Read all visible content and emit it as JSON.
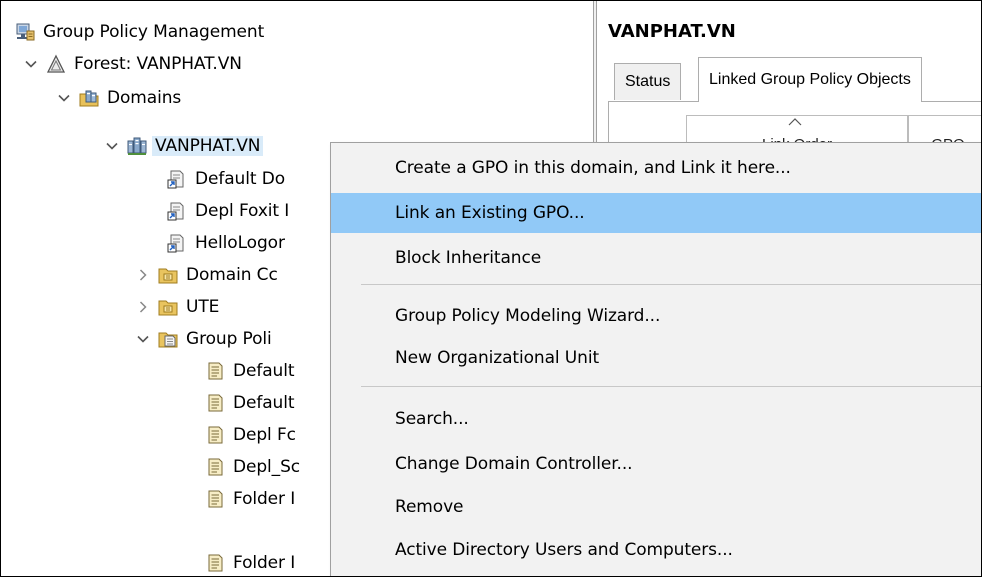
{
  "tree": {
    "root": "Group Policy Management",
    "forest": "Forest: VANPHAT.VN",
    "domains": "Domains",
    "domain": "VANPHAT.VN",
    "links": [
      "Default Do",
      "Depl Foxit I",
      "HelloLogor"
    ],
    "ous": [
      "Domain Cc",
      "UTE"
    ],
    "gpo_container": "Group Poli",
    "gpos": [
      "Default",
      "Default",
      "Depl Fc",
      "Depl_Sc",
      "Folder I",
      "Folder I"
    ]
  },
  "details": {
    "title": "VANPHAT.VN",
    "tabs": [
      "Status",
      "Linked Group Policy Objects"
    ],
    "columns": [
      "Link Order",
      "GPO"
    ]
  },
  "context_menu": {
    "items": [
      "Create a GPO in this domain, and Link it here...",
      "Link an Existing GPO...",
      "Block Inheritance",
      "Group Policy Modeling Wizard...",
      "New Organizational Unit",
      "Search...",
      "Change Domain Controller...",
      "Remove",
      "Active Directory Users and Computers..."
    ],
    "highlighted_index": 1
  },
  "colors": {
    "menu_highlight": "#91c9f7",
    "selection": "#d9ebf9",
    "menu_background": "#f2f2f2"
  },
  "icons": [
    "gpm-console-icon",
    "forest-icon",
    "domains-icon",
    "domain-icon",
    "gpo-link-icon",
    "ou-folder-icon",
    "gpo-folder-icon",
    "gpo-icon"
  ]
}
